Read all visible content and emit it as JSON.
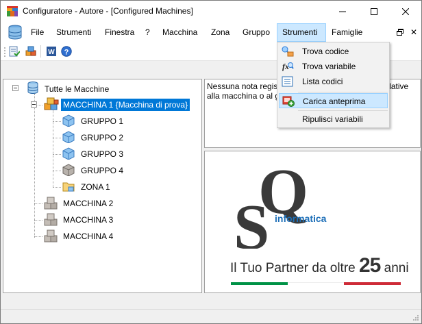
{
  "window": {
    "title": "Configuratore - Autore - [Configured Machines]",
    "controls": [
      "minimize",
      "maximize",
      "close"
    ]
  },
  "menubar": {
    "items": [
      {
        "label": "File"
      },
      {
        "label": "Strumenti"
      },
      {
        "label": "Finestra"
      },
      {
        "label": "?"
      },
      {
        "label": "Macchina"
      },
      {
        "label": "Zona"
      },
      {
        "label": "Gruppo"
      },
      {
        "label": "Strumenti",
        "open": true
      },
      {
        "label": "Famiglie"
      }
    ],
    "mdi_restore_icon": "restore-icon",
    "mdi_close_label": "✕"
  },
  "toolbar": {
    "icons": [
      "check-document-icon",
      "cubes-icon",
      "word-icon",
      "help-icon"
    ]
  },
  "dropdown": {
    "items": [
      {
        "label": "Trova codice",
        "icon": "find-code-icon"
      },
      {
        "label": "Trova variabile",
        "icon": "find-variable-icon"
      },
      {
        "label": "Lista codici",
        "icon": "list-icon"
      },
      {
        "label": "Carica anteprima",
        "icon": "load-preview-icon",
        "highlighted": true
      },
      {
        "label": "Ripulisci variabili",
        "icon": ""
      }
    ]
  },
  "tree": {
    "root": "Tutte le Macchine",
    "machine1": "MACCHINA 1 {Macchina di prova}",
    "groups": [
      "GRUPPO 1",
      "GRUPPO 2",
      "GRUPPO 3",
      "GRUPPO 4"
    ],
    "zone": "ZONA 1",
    "machines": [
      "MACCHINA 2",
      "MACCHINA 3",
      "MACCHINA 4"
    ]
  },
  "notes": {
    "text": "Nessuna nota registrata. Inserire eventuali note relative alla macchina o al gruppo."
  },
  "logo": {
    "letters": [
      "Q",
      "S"
    ],
    "brand": "informatica",
    "tagline_prefix": "Il Tuo Partner da oltre ",
    "tagline_number": "25",
    "tagline_suffix": " anni",
    "colors": {
      "green": "#009246",
      "white": "#ffffff",
      "red": "#ce2b37",
      "blue": "#1d6fb8",
      "dark": "#3a3a3a"
    }
  },
  "colors": {
    "selection": "#0078d7",
    "menu_highlight": "#cce8ff"
  }
}
